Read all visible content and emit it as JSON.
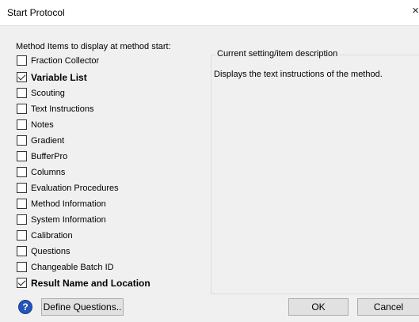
{
  "window": {
    "title": "Start Protocol",
    "close_glyph": "×"
  },
  "method_items_label": "Method Items to display at method start:",
  "items": [
    {
      "label": "Fraction Collector",
      "checked": false,
      "bold": false
    },
    {
      "label": "Variable List",
      "checked": true,
      "bold": true
    },
    {
      "label": "Scouting",
      "checked": false,
      "bold": false
    },
    {
      "label": "Text Instructions",
      "checked": false,
      "bold": false
    },
    {
      "label": "Notes",
      "checked": false,
      "bold": false
    },
    {
      "label": "Gradient",
      "checked": false,
      "bold": false
    },
    {
      "label": "BufferPro",
      "checked": false,
      "bold": false
    },
    {
      "label": "Columns",
      "checked": false,
      "bold": false
    },
    {
      "label": "Evaluation Procedures",
      "checked": false,
      "bold": false
    },
    {
      "label": "Method Information",
      "checked": false,
      "bold": false
    },
    {
      "label": "System Information",
      "checked": false,
      "bold": false
    },
    {
      "label": "Calibration",
      "checked": false,
      "bold": false
    },
    {
      "label": "Questions",
      "checked": false,
      "bold": false
    },
    {
      "label": "Changeable Batch ID",
      "checked": false,
      "bold": false
    },
    {
      "label": "Result Name and Location",
      "checked": true,
      "bold": true
    }
  ],
  "description_group": {
    "title": "Current setting/item description",
    "text": "Displays the text instructions of the method."
  },
  "buttons": {
    "help_glyph": "?",
    "define_questions": "Define Questions..",
    "ok": "OK",
    "cancel": "Cancel"
  },
  "colors": {
    "help_icon": "#2455b8",
    "dialog_bg": "#f0f0f0"
  }
}
